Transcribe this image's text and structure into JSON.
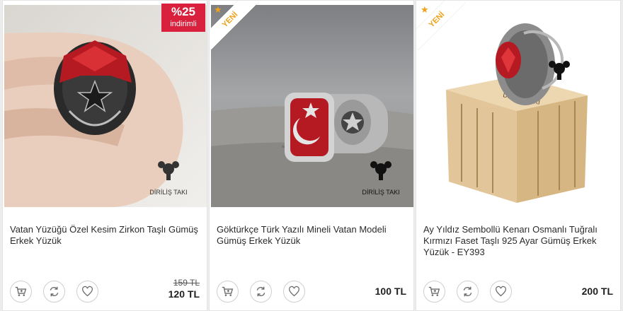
{
  "products": [
    {
      "title": "Vatan Yüzüğü Özel Kesim Zirkon Taşlı Gümüş Erkek Yüzük",
      "old_price": "159 TL",
      "price": "120 TL",
      "badge": {
        "percent": "%25",
        "label": "indirimli"
      }
    },
    {
      "title": "Göktürkçe Türk Yazılı Mineli Vatan Modeli Gümüş Erkek Yüzük",
      "price": "100 TL",
      "ribbon": "YENİ"
    },
    {
      "title": "Ay Yıldız Sembollü Kenarı Osmanlı Tuğralı Kırmızı Faset Taşlı 925 Ayar Gümüş Erkek Yüzük - EY393",
      "price": "200 TL",
      "ribbon": "YENİ"
    }
  ],
  "logo_text": "DİRİLİŞ TAKI",
  "icons": {
    "cart": "cart-icon",
    "compare": "compare-icon",
    "favorite": "heart-icon",
    "star": "star-icon"
  },
  "colors": {
    "discount": "#d9203c",
    "ribbon_text": "#f0a21a",
    "ring_stone": "#b51a22"
  }
}
